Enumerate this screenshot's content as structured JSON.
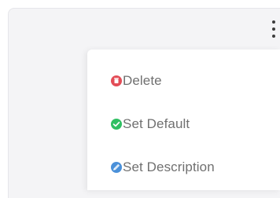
{
  "menu": {
    "items": [
      {
        "label": "Delete",
        "icon": "delete-icon",
        "icon_color": "#e34d57"
      },
      {
        "label": "Set Default",
        "icon": "check-icon",
        "icon_color": "#2fbf62"
      },
      {
        "label": "Set Description",
        "icon": "description-icon",
        "icon_color": "#4a90d9"
      }
    ]
  },
  "colors": {
    "card_background": "#f4f4f6",
    "menu_background": "#ffffff",
    "menu_text": "#707070"
  }
}
